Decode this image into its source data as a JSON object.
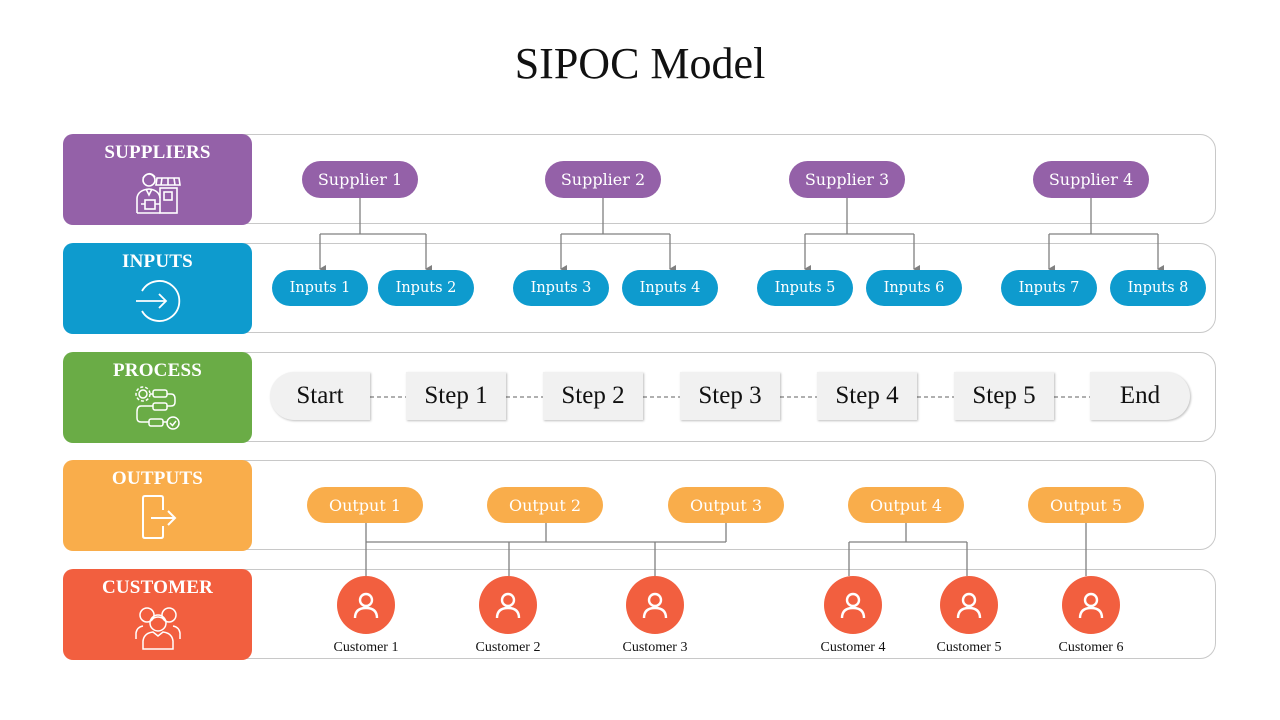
{
  "title": "SIPOC Model",
  "colors": {
    "suppliers": "#9461a8",
    "inputs": "#0e9bce",
    "process": "#6aac46",
    "outputs": "#f9ad4b",
    "customer": "#f25f3f",
    "connector": "#808080"
  },
  "rows": [
    {
      "key": "suppliers",
      "label": "SUPPLIERS",
      "icon": "supplier-shop-icon"
    },
    {
      "key": "inputs",
      "label": "INPUTS",
      "icon": "sign-in-arrow-icon"
    },
    {
      "key": "process",
      "label": "PROCESS",
      "icon": "process-flow-icon"
    },
    {
      "key": "outputs",
      "label": "OUTPUTS",
      "icon": "exit-door-icon"
    },
    {
      "key": "customer",
      "label": "CUSTOMER",
      "icon": "customer-group-icon"
    }
  ],
  "suppliers": [
    "Supplier 1",
    "Supplier 2",
    "Supplier 3",
    "Supplier 4"
  ],
  "inputs": [
    "Inputs 1",
    "Inputs 2",
    "Inputs 3",
    "Inputs 4",
    "Inputs 5",
    "Inputs 6",
    "Inputs 7",
    "Inputs 8"
  ],
  "process": [
    "Start",
    "Step 1",
    "Step 2",
    "Step 3",
    "Step 4",
    "Step 5",
    "End"
  ],
  "outputs": [
    "Output 1",
    "Output 2",
    "Output 3",
    "Output 4",
    "Output 5"
  ],
  "customers": [
    "Customer 1",
    "Customer 2",
    "Customer 3",
    "Customer 4",
    "Customer 5",
    "Customer 6"
  ]
}
